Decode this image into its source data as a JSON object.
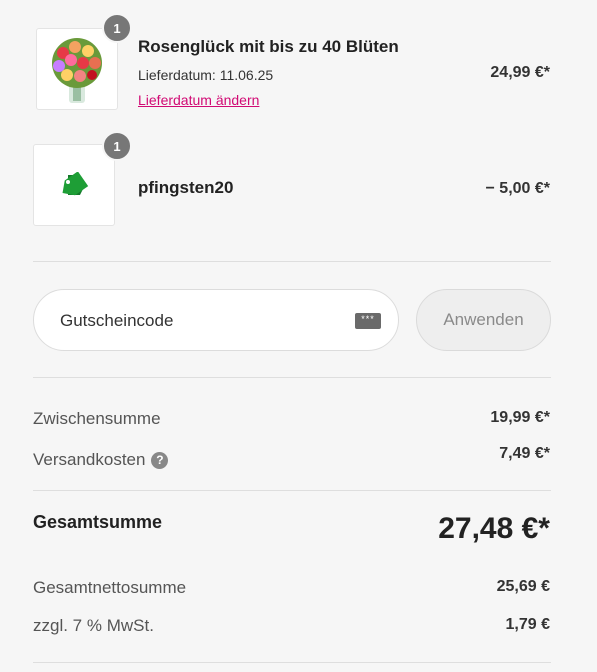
{
  "items": [
    {
      "quantity": "1",
      "title": "Rosenglück mit bis zu 40 Blüten",
      "delivery_date": "Lieferdatum: 11.06.25",
      "change_link": "Lieferdatum ändern",
      "price": "24,99 €*",
      "icon": "flower-bouquet-icon"
    },
    {
      "quantity": "1",
      "title": "pfingsten20",
      "price": "− 5,00 €*",
      "icon": "price-tag-icon"
    }
  ],
  "voucher": {
    "placeholder": "Gutscheincode",
    "apply_label": "Anwenden",
    "keyboard_icon_text": "***"
  },
  "summary": {
    "subtotal_label": "Zwischensumme",
    "subtotal_value": "19,99 €*",
    "shipping_label": "Versandkosten",
    "shipping_help": "?",
    "shipping_value": "7,49 €*",
    "total_label": "Gesamtsumme",
    "total_value": "27,48 €*",
    "net_label": "Gesamtnettosumme",
    "net_value": "25,69 €",
    "vat_label": "zzgl. 7 % MwSt.",
    "vat_value": "1,79 €"
  },
  "colors": {
    "link": "#d10a74",
    "tag_green": "#1e9e36",
    "badge": "#777777"
  }
}
